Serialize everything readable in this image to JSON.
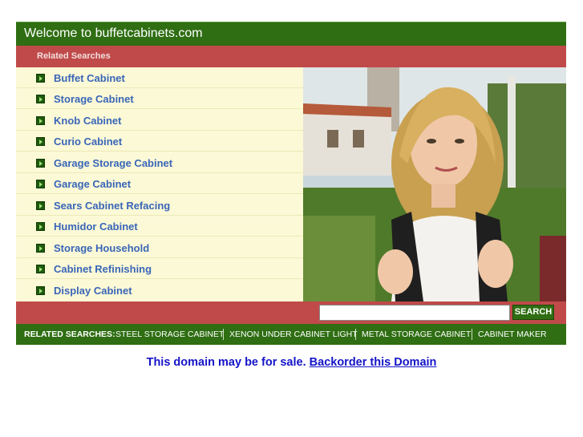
{
  "header": {
    "title": "Welcome to buffetcabinets.com"
  },
  "related": {
    "heading": "Related Searches",
    "items": [
      {
        "label": "Buffet Cabinet"
      },
      {
        "label": "Storage Cabinet"
      },
      {
        "label": "Knob Cabinet"
      },
      {
        "label": "Curio Cabinet"
      },
      {
        "label": "Garage Storage Cabinet"
      },
      {
        "label": "Garage Cabinet"
      },
      {
        "label": "Sears Cabinet Refacing"
      },
      {
        "label": "Humidor Cabinet"
      },
      {
        "label": "Storage Household"
      },
      {
        "label": "Cabinet Refinishing"
      },
      {
        "label": "Display Cabinet"
      }
    ]
  },
  "search": {
    "value": "",
    "button_label": "SEARCH"
  },
  "footer": {
    "label": "RELATED SEARCHES:",
    "links": [
      "STEEL STORAGE CABINET",
      "XENON UNDER CABINET LIGHT",
      "METAL STORAGE CABINET",
      "CABINET MAKER"
    ]
  },
  "sale": {
    "text": "This domain may be for sale.",
    "link": "Backorder this Domain"
  },
  "colors": {
    "green": "#2f6e13",
    "red": "#c04a4a",
    "list_bg": "#fbf9d6",
    "link_blue": "#3a66b8",
    "sale_blue": "#1414c8"
  }
}
